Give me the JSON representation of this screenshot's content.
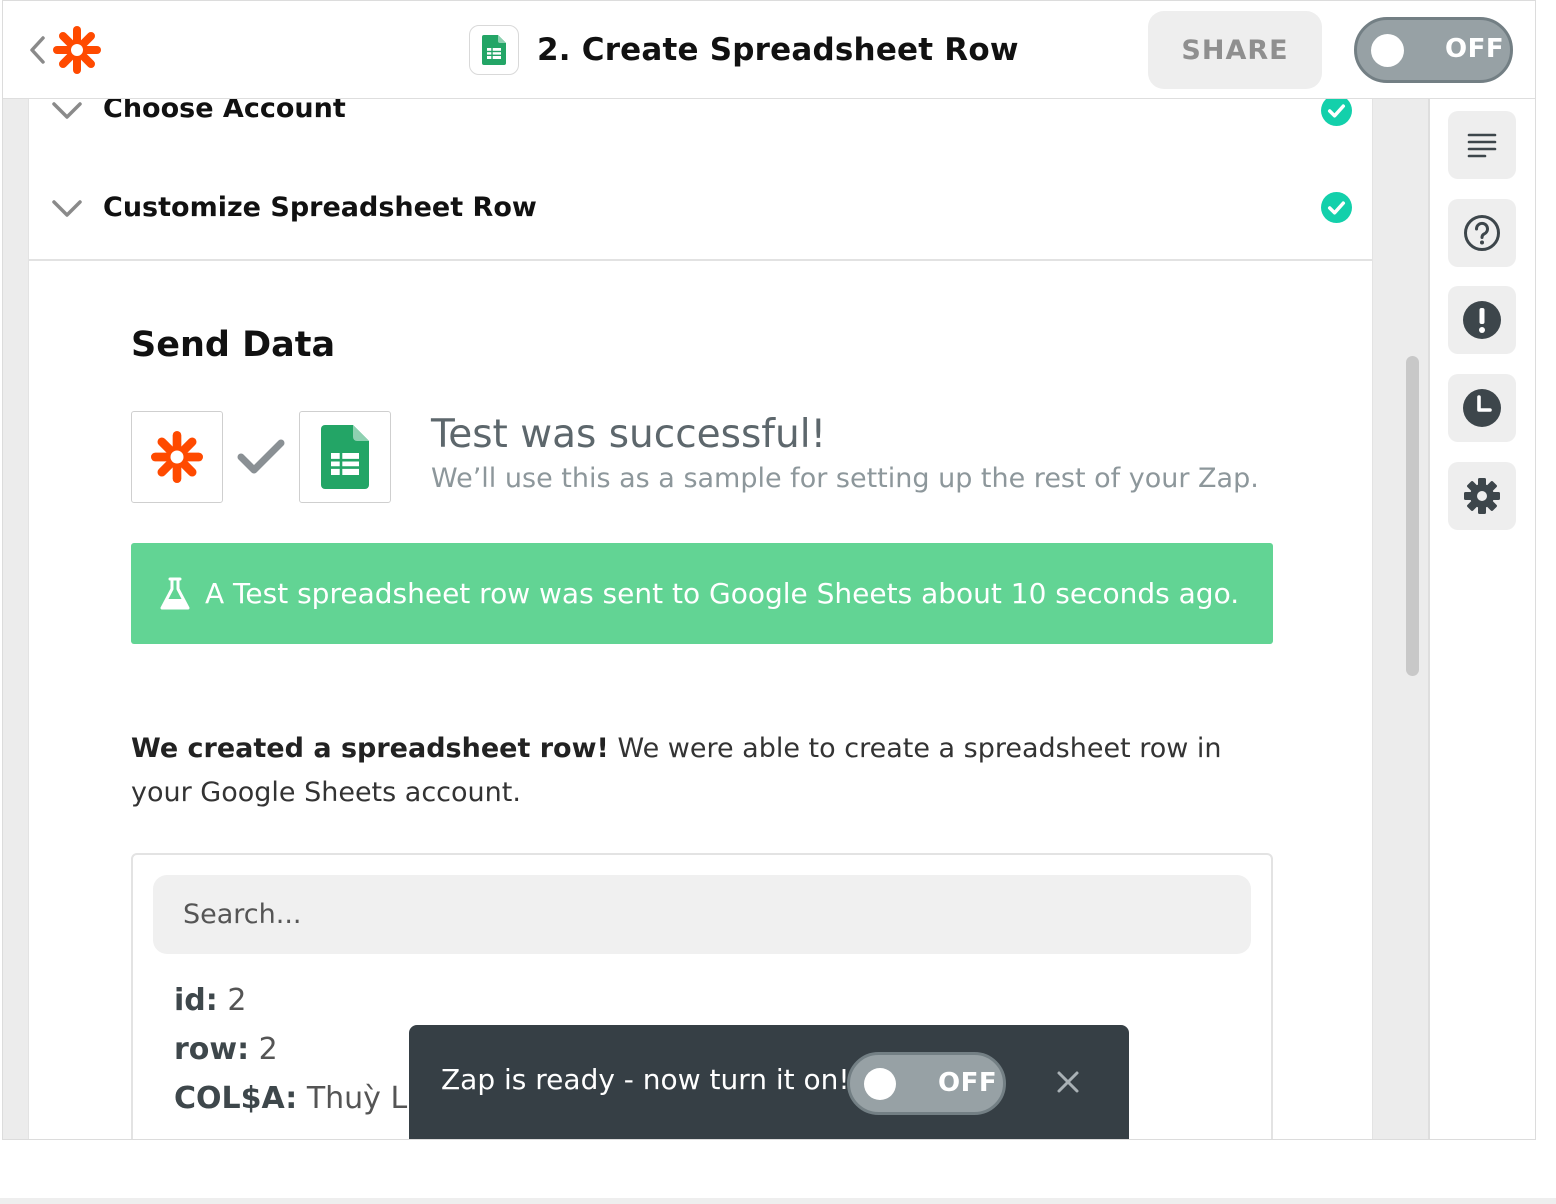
{
  "header": {
    "title": "2. Create Spreadsheet Row",
    "share_label": "SHARE",
    "toggle_label": "OFF"
  },
  "sections": {
    "account_label": "Choose Account",
    "customize_label": "Customize Spreadsheet Row"
  },
  "send_data": {
    "title": "Send Data",
    "success_title": "Test was successful!",
    "success_subtitle": "We’ll use this as a sample for setting up the rest of your Zap.",
    "banner_text": "A Test spreadsheet row was sent to Google Sheets about 10 seconds ago.",
    "created_bold": "We created a spreadsheet row!",
    "created_text": " We were able to create a spreadsheet row in your Google Sheets account."
  },
  "search": {
    "placeholder": "Search..."
  },
  "fields": [
    {
      "key": "id:",
      "value": "2"
    },
    {
      "key": "row:",
      "value": "2"
    },
    {
      "key": "COL$A:",
      "value": "Thuỳ Linh"
    }
  ],
  "toast": {
    "message": "Zap is ready - now turn it on!",
    "toggle_label": "OFF"
  },
  "icons": {
    "back": "chevron-left-icon",
    "logo": "zapier-logo",
    "sheets": "google-sheets-icon",
    "sidebar": [
      "details-icon",
      "help-icon",
      "alert-icon",
      "history-icon",
      "settings-icon"
    ],
    "close": "close-icon"
  },
  "colors": {
    "zapier_orange": "#ff4a00",
    "success_green": "#62d494",
    "check_teal": "#13d0ab",
    "sheets_green": "#23a566",
    "toast_bg": "#363f45"
  }
}
